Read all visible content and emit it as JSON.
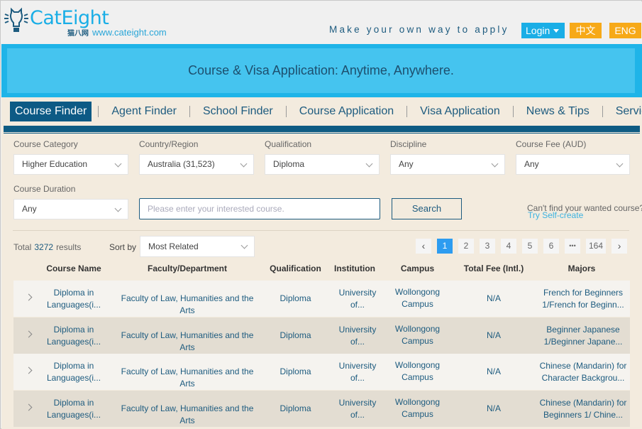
{
  "header": {
    "logo_text": "CatEight",
    "logo_cn": "猫八网",
    "site_url": "www.cateight.com",
    "tagline": "Make your own way to apply",
    "login_label": "Login",
    "lang_cn_label": "中文",
    "lang_en_label": "ENG"
  },
  "banner": {
    "text": "Course & Visa Application: Anytime, Anywhere."
  },
  "nav": {
    "items": [
      {
        "label": "Course Finder",
        "active": true
      },
      {
        "label": "Agent Finder"
      },
      {
        "label": "School Finder"
      },
      {
        "label": "Course Application"
      },
      {
        "label": "Visa Application"
      },
      {
        "label": "News & Tips"
      },
      {
        "label": "Services"
      }
    ]
  },
  "filters": {
    "course_category": {
      "label": "Course Category",
      "value": "Higher Education"
    },
    "country_region": {
      "label": "Country/Region",
      "value": "Australia (31,523)"
    },
    "qualification": {
      "label": "Qualification",
      "value": "Diploma"
    },
    "discipline": {
      "label": "Discipline",
      "value": "Any"
    },
    "course_fee": {
      "label": "Course Fee (AUD)",
      "value": "Any"
    },
    "course_duration": {
      "label": "Course Duration",
      "value": "Any"
    },
    "search_placeholder": "Please enter your interested course.",
    "search_button": "Search",
    "cant_find": "Can't find your wanted course?",
    "self_create": "Try Self-create"
  },
  "results": {
    "total_prefix": "Total",
    "total_count": "3272",
    "total_suffix": "results",
    "sort_label": "Sort by",
    "sort_value": "Most Related",
    "pagination": {
      "prev": "‹",
      "pages": [
        "1",
        "2",
        "3",
        "4",
        "5",
        "6",
        "•••",
        "164"
      ],
      "current": "1",
      "next": "›"
    }
  },
  "table": {
    "columns": [
      "Course Name",
      "Faculty/Department",
      "Qualification",
      "Institution",
      "Campus",
      "Total Fee (Intl.)",
      "Majors"
    ],
    "rows": [
      {
        "course_name": [
          "Diploma in",
          "Languages(i..."
        ],
        "faculty": "Faculty of Law, Humanities and the Arts",
        "qualification": "Diploma",
        "institution": [
          "University",
          "of..."
        ],
        "campus": [
          "Wollongong",
          "Campus"
        ],
        "fee": "N/A",
        "majors": [
          "French for Beginners",
          "1/French for Beginn..."
        ]
      },
      {
        "course_name": [
          "Diploma in",
          "Languages(i..."
        ],
        "faculty": "Faculty of Law, Humanities and the Arts",
        "qualification": "Diploma",
        "institution": [
          "University",
          "of..."
        ],
        "campus": [
          "Wollongong",
          "Campus"
        ],
        "fee": "N/A",
        "majors": [
          "Beginner Japanese",
          "1/Beginner Japane..."
        ]
      },
      {
        "course_name": [
          "Diploma in",
          "Languages(i..."
        ],
        "faculty": "Faculty of Law, Humanities and the Arts",
        "qualification": "Diploma",
        "institution": [
          "University",
          "of..."
        ],
        "campus": [
          "Wollongong",
          "Campus"
        ],
        "fee": "N/A",
        "majors": [
          "Chinese (Mandarin) for",
          "Character Backgrou..."
        ]
      },
      {
        "course_name": [
          "Diploma in",
          "Languages(i..."
        ],
        "faculty": "Faculty of Law, Humanities and the Arts",
        "qualification": "Diploma",
        "institution": [
          "University",
          "of..."
        ],
        "campus": [
          "Wollongong",
          "Campus"
        ],
        "fee": "N/A",
        "majors": [
          "Chinese (Mandarin) for",
          "Beginners 1/ Chine..."
        ]
      }
    ]
  },
  "colors": {
    "brand_blue": "#1aaee6",
    "nav_dark": "#0d5a85",
    "accent_orange": "#f7a918",
    "page_active": "#2d9cf0",
    "cream_bg": "#f3ebde"
  }
}
